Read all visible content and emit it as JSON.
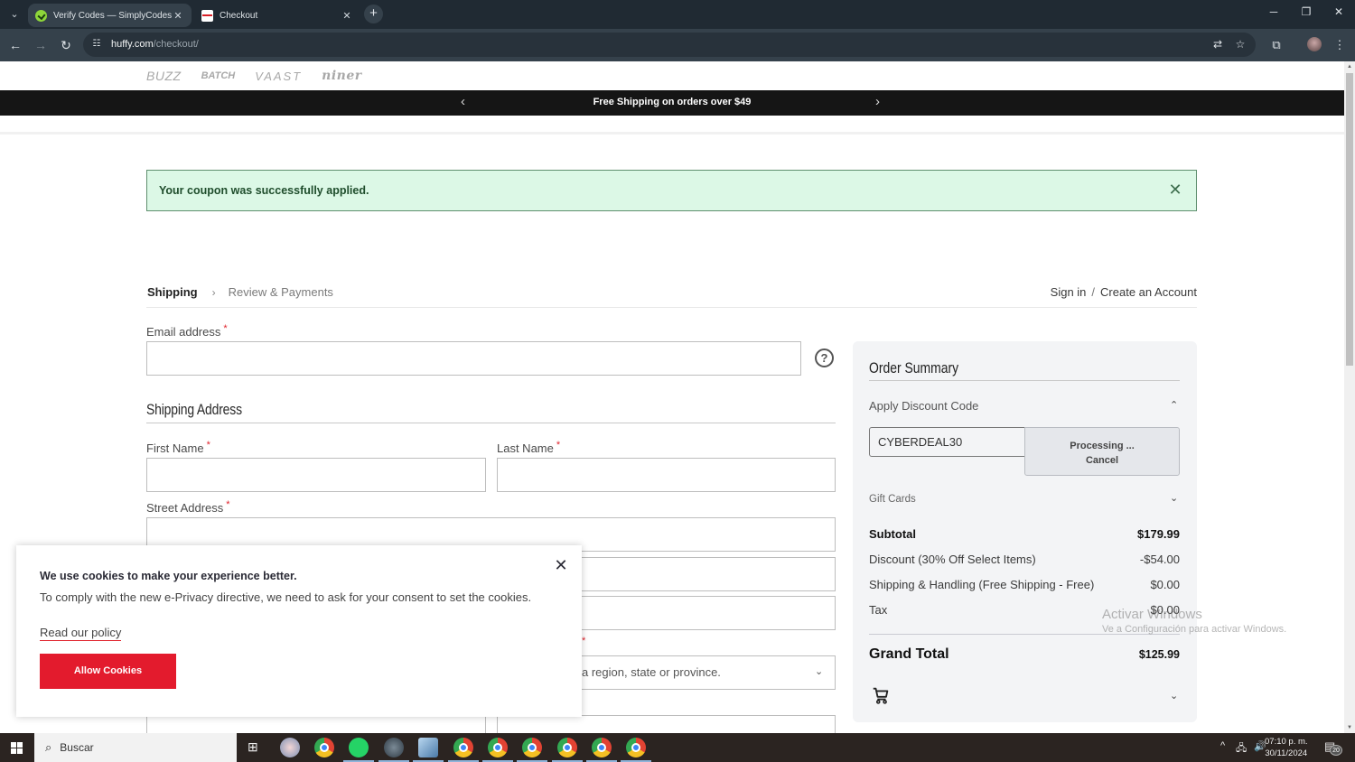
{
  "browser": {
    "tabs": [
      {
        "title": "Verify Codes — SimplyCodes",
        "favicon": "simplycodes-icon",
        "active": false
      },
      {
        "title": "Checkout",
        "favicon": "huffy-icon",
        "active": true
      }
    ],
    "new_tab": "+",
    "url_host": "huffy.com",
    "url_path": "/checkout/",
    "window_controls": {
      "minimize": "—",
      "restore": "❐",
      "close": "✕"
    }
  },
  "page": {
    "brands": [
      "BUZZ",
      "BATCH",
      "VAAST",
      "niner"
    ],
    "promo": {
      "text": "Free Shipping on orders over $49",
      "prev": "‹",
      "next": "›"
    },
    "alert": {
      "message": "Your coupon was successfully applied.",
      "close": "✕",
      "color": "#dcf8e6"
    },
    "steps": {
      "current": "Shipping",
      "separator": "›",
      "next": "Review & Payments"
    },
    "auth": {
      "sign_in": "Sign in",
      "slash": "/",
      "create": "Create an Account"
    },
    "form": {
      "email_label": "Email address",
      "required_mark": "*",
      "email_value": "",
      "help": "?",
      "shipping_title": "Shipping Address",
      "first_name_label": "First Name",
      "last_name_label": "Last Name",
      "street_label": "Street Address",
      "region_placeholder": "Please select a region, state or province.",
      "region_visible": "a region, state or province."
    },
    "summary": {
      "title": "Order Summary",
      "discount_heading": "Apply Discount Code",
      "discount_code": "CYBERDEAL30",
      "processing": "Processing ...",
      "cancel": "Cancel",
      "gift_cards": "Gift Cards",
      "rows": [
        {
          "label": "Subtotal",
          "value": "$179.99",
          "bold": true
        },
        {
          "label": "Discount (30% Off Select Items)",
          "value": "-$54.00"
        },
        {
          "label": "Shipping & Handling (Free Shipping - Free)",
          "value": "$0.00"
        },
        {
          "label": "Tax",
          "value": "$0.00"
        }
      ],
      "grand_total_label": "Grand Total",
      "grand_total_value": "$125.99"
    },
    "cookie": {
      "heading": "We use cookies to make your experience better.",
      "body": "To comply with the new e-Privacy directive, we need to ask for your consent to set the cookies.",
      "policy_link": "Read our policy",
      "allow": "Allow Cookies",
      "close": "✕",
      "accent": "#e31b2d"
    },
    "watermark": {
      "line1": "Activar Windows",
      "line2": "Ve a Configuración para activar Windows."
    }
  },
  "taskbar": {
    "search": "Buscar",
    "time": "07:10 p. m.",
    "date": "30/11/2024",
    "notifications": "20"
  }
}
